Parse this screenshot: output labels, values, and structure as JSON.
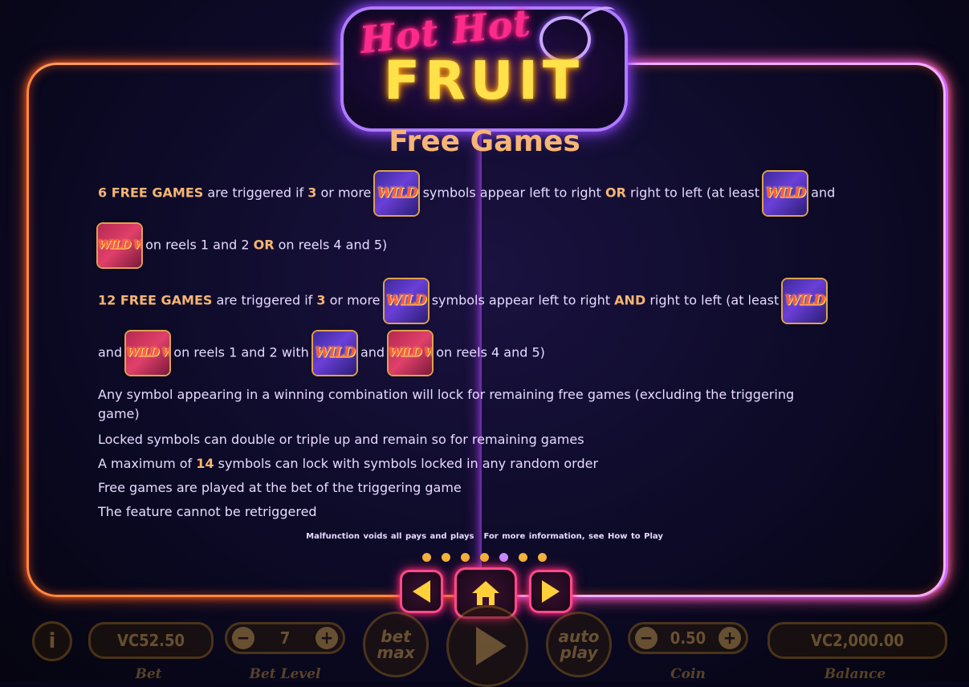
{
  "logo": {
    "line1": "Hot Hot",
    "line2": "FRUIT"
  },
  "title": "Free Games",
  "symbols": {
    "wild": "WILD",
    "wild_double": "WILD WILD"
  },
  "rules": {
    "six": {
      "count": "6 FREE GAMES",
      "t1": " are triggered if ",
      "n": "3",
      "t2": " or more ",
      "t3": " symbols appear left to right ",
      "or1": "OR",
      "t4": " right to left (at least ",
      "t5": " and",
      "t6": " on reels 1 and 2 ",
      "or2": "OR",
      "t7": " on reels 4 and 5)"
    },
    "twelve": {
      "count": "12 FREE GAMES",
      "t1": " are triggered if ",
      "n": "3",
      "t2": " or more ",
      "t3": " symbols appear left to right ",
      "and1": "AND",
      "t4": " right to left (at least",
      "t5": "and",
      "t6": " on reels 1 and 2 with ",
      "t7": " and ",
      "t8": " on reels 4 and 5)"
    },
    "lock1": "Any symbol appearing in a winning combination will lock for remaining free games (excluding the triggering",
    "lock1b": "game)",
    "lock2": "Locked symbols can double or triple up and remain so for remaining games",
    "max_pre": "A maximum of ",
    "max_n": "14",
    "max_post": " symbols can lock with symbols locked in any random order",
    "bet": "Free games are played at the bet of the triggering game",
    "retrigger": "The feature cannot be retriggered"
  },
  "footer": {
    "malfunction": "Malfunction voids all pays and plays",
    "more_info": "For more information, see How to Play"
  },
  "pagination": {
    "total": 7,
    "active_index": 4
  },
  "controls": {
    "info_icon": "i",
    "bet_value": "VC52.50",
    "bet_label": "Bet",
    "bet_level_value": "7",
    "bet_level_label": "Bet Level",
    "bet_max_label": "bet max",
    "auto_play_label": "auto play",
    "coin_value": "0.50",
    "coin_label": "Coin",
    "balance_value": "VC2,000.00",
    "balance_label": "Balance",
    "minus": "−",
    "plus": "+"
  }
}
